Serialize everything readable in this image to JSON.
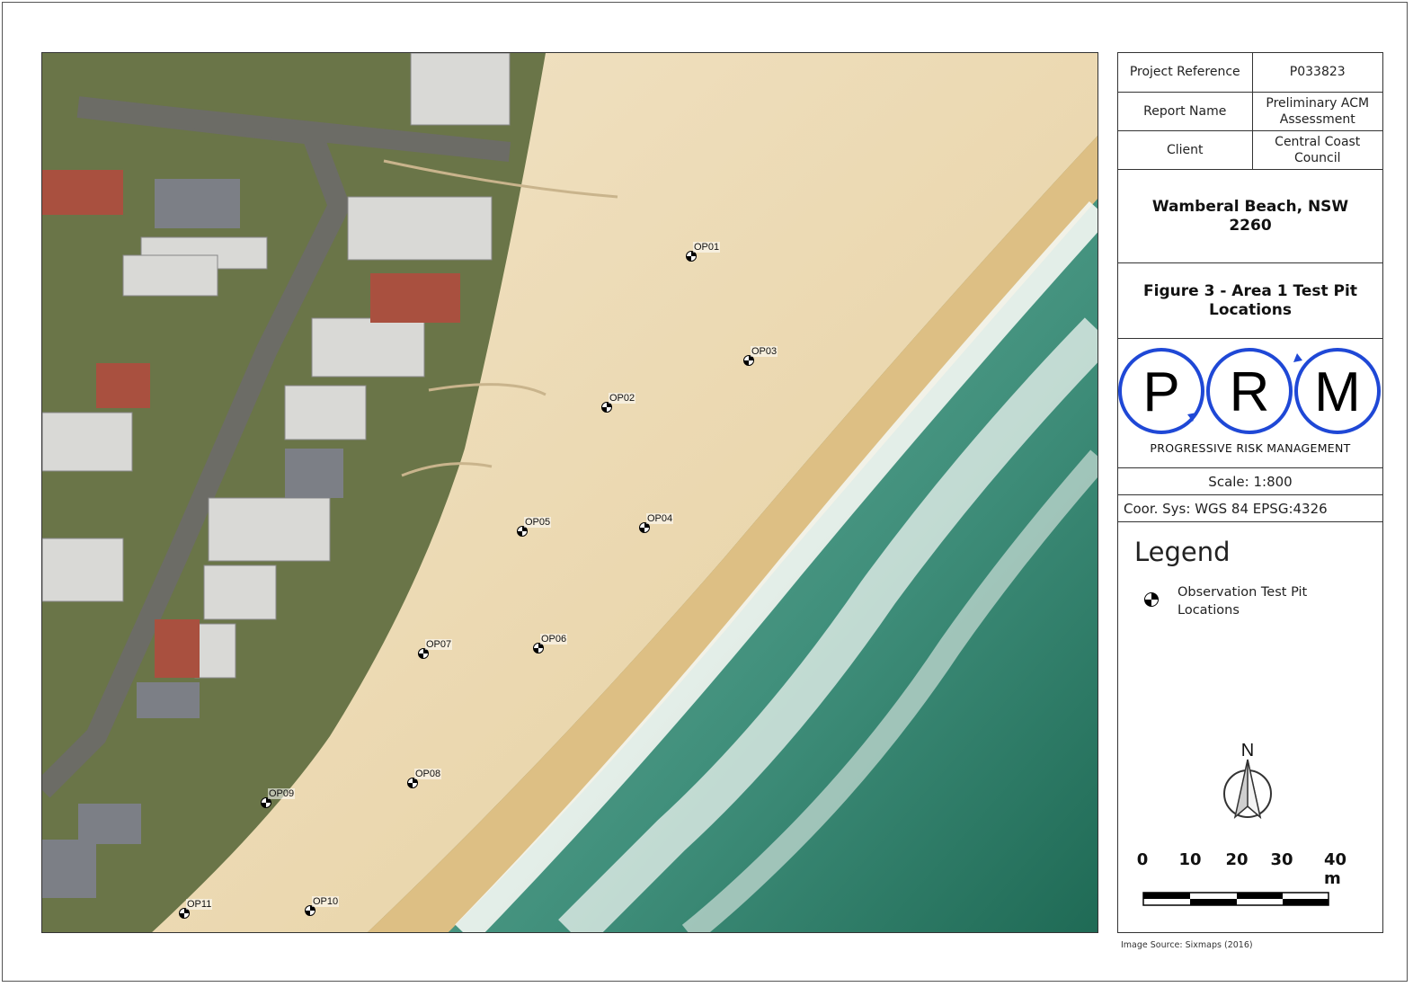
{
  "info": {
    "project_reference_label": "Project Reference",
    "project_reference_value": "P033823",
    "report_name_label": "Report Name",
    "report_name_value": "Preliminary ACM Assessment",
    "client_label": "Client",
    "client_value": "Central Coast Council"
  },
  "location_title": "Wamberal Beach, NSW 2260",
  "figure_title": "Figure 3 - Area 1 Test Pit Locations",
  "logo": {
    "letter_1": "P",
    "letter_2": "R",
    "letter_3": "M",
    "tagline": "PROGRESSIVE RISK MANAGEMENT",
    "ring_color": "#1f48d6"
  },
  "scale_text": "Scale: 1:800",
  "coord_sys_text": "Coor. Sys: WGS 84 EPSG:4326",
  "legend": {
    "title": "Legend",
    "item_label": "Observation Test Pit Locations",
    "item_icon": "test-pit-symbol-icon"
  },
  "north_label": "N",
  "scale_bar": {
    "labels": [
      "0",
      "10",
      "20",
      "30",
      "40 m"
    ],
    "unit": "m"
  },
  "image_source": "Image Source: Sixmaps (2016)",
  "test_pits": [
    {
      "id": "OP01"
    },
    {
      "id": "OP02"
    },
    {
      "id": "OP03"
    },
    {
      "id": "OP04"
    },
    {
      "id": "OP05"
    },
    {
      "id": "OP06"
    },
    {
      "id": "OP07"
    },
    {
      "id": "OP08"
    },
    {
      "id": "OP09"
    },
    {
      "id": "OP10"
    },
    {
      "id": "OP11"
    }
  ]
}
